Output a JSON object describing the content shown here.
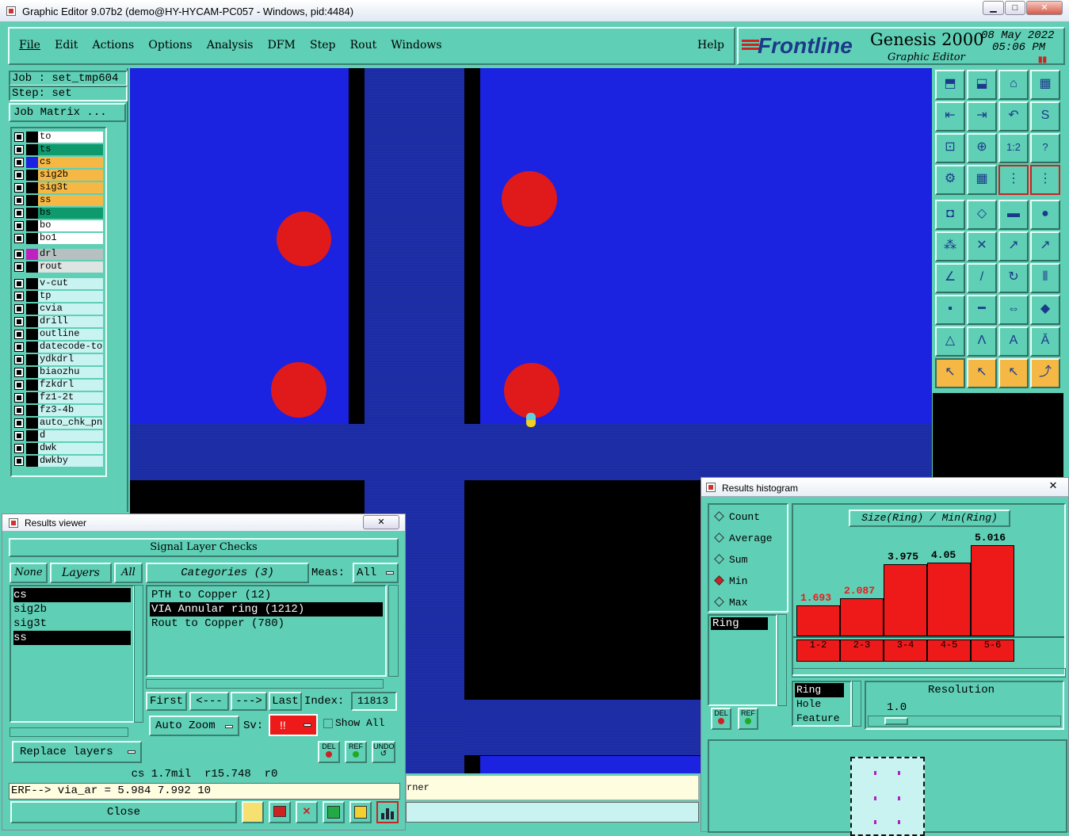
{
  "window": {
    "title": "Graphic Editor 9.07b2 (demo@HY-HYCAM-PC057 - Windows, pid:4484)"
  },
  "menu": {
    "items": [
      "File",
      "Edit",
      "Actions",
      "Options",
      "Analysis",
      "DFM",
      "Step",
      "Rout",
      "Windows"
    ],
    "help": "Help"
  },
  "brand": {
    "logo": "Frontline",
    "product": "Genesis 2000",
    "subtitle": "Graphic Editor",
    "date": "08 May 2022",
    "time": "05:06 PM"
  },
  "job": {
    "job_label": "Job : set_tmp604",
    "step_label": "Step: set",
    "matrix_button": "Job Matrix ..."
  },
  "layers": {
    "group1": [
      {
        "name": "to",
        "bg": "#ffffff"
      },
      {
        "name": "ts",
        "bg": "#0f9a6e"
      },
      {
        "name": "cs",
        "bg": "#f5b845",
        "active": true
      },
      {
        "name": "sig2b",
        "bg": "#f5b845"
      },
      {
        "name": "sig3t",
        "bg": "#f5b845"
      },
      {
        "name": "ss",
        "bg": "#f5b845"
      },
      {
        "name": "bs",
        "bg": "#0f9a6e"
      },
      {
        "name": "bo",
        "bg": "#ffffff"
      },
      {
        "name": "bo1",
        "bg": "#ffffff"
      }
    ],
    "group2": [
      {
        "name": "drl",
        "bg": "#b6c0c0",
        "swatch": "#c020c0"
      },
      {
        "name": "rout",
        "bg": "#dde4e2"
      }
    ],
    "group3": [
      "v-cut",
      "tp",
      "cvia",
      "drill",
      "outline",
      "datecode-to",
      "ydkdrl",
      "biaozhu",
      "fzkdrl",
      "fz1-2t",
      "fz3-4b",
      "auto_chk_pn",
      "d",
      "dwk",
      "dwkby"
    ]
  },
  "results_viewer": {
    "title": "Results viewer",
    "header": "Signal Layer Checks",
    "none_btn": "None",
    "layers_btn": "Layers",
    "all_btn": "All",
    "categories_btn": "Categories (3)",
    "meas_label": "Meas:",
    "meas_value": "All",
    "layer_list": [
      "cs",
      "sig2b",
      "sig3t",
      "ss"
    ],
    "categories": [
      "PTH to Copper (12)",
      "VIA Annular ring (1212)",
      "Rout to Copper (780)"
    ],
    "nav": {
      "first": "First",
      "prev": "<---",
      "next": "--->",
      "last": "Last",
      "index_label": "Index:",
      "index_value": "11813"
    },
    "auto_zoom": "Auto Zoom",
    "sv_label": "Sv:",
    "sv_value": "!!",
    "show_all": "Show All",
    "replace": "Replace layers",
    "del": "DEL",
    "ref": "REF",
    "undo": "UNDO",
    "status": "cs 1.7mil  r15.748  r0",
    "erf": "ERF--> via_ar = 5.984 7.992 10",
    "close": "Close"
  },
  "histogram": {
    "title": "Results histogram",
    "radio": [
      "Count",
      "Average",
      "Sum",
      "Min",
      "Max"
    ],
    "selected": "Min",
    "chart_title": "Size(Ring) / Min(Ring)",
    "list_selected": "Ring",
    "list2": [
      "Ring",
      "Hole",
      "Feature"
    ],
    "resolution_label": "Resolution",
    "resolution_value": "1.0",
    "del": "DEL",
    "ref": "REF"
  },
  "statusbar": {
    "text": "rner"
  },
  "chart_data": {
    "type": "bar",
    "title": "Size(Ring) / Min(Ring)",
    "categories": [
      "1-2",
      "2-3",
      "3-4",
      "4-5",
      "5-6"
    ],
    "values": [
      1.693,
      2.087,
      3.975,
      4.05,
      5.016
    ],
    "ylim": [
      0,
      6
    ],
    "bar_color": "#ee1a1a"
  }
}
